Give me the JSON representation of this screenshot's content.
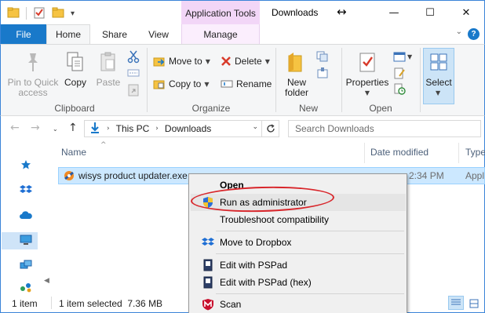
{
  "title_bar": {
    "context_tab_title": "Application Tools",
    "window_title": "Downloads",
    "move_cursor_glyph": "↔",
    "minimize_glyph": "—",
    "maximize_glyph": "☐",
    "close_glyph": "✕"
  },
  "tabs": {
    "file": "File",
    "home": "Home",
    "share": "Share",
    "view": "View",
    "manage": "Manage",
    "help": "?"
  },
  "ribbon": {
    "clipboard": {
      "pin": "Pin to Quick access",
      "copy": "Copy",
      "paste": "Paste",
      "label": "Clipboard"
    },
    "organize": {
      "move_to": "Move to",
      "copy_to": "Copy to",
      "delete": "Delete",
      "rename": "Rename",
      "label": "Organize"
    },
    "new": {
      "new_folder": "New folder",
      "label": "New"
    },
    "open": {
      "properties": "Properties",
      "label": "Open"
    },
    "select": {
      "select": "Select"
    }
  },
  "address": {
    "path": [
      "This PC",
      "Downloads"
    ],
    "search_placeholder": "Search Downloads"
  },
  "columns": {
    "name": "Name",
    "date_modified": "Date modified",
    "type": "Type"
  },
  "files": [
    {
      "name": "wisys product updater.exe",
      "date_partial": "2:34 PM",
      "type_partial": "Appl"
    }
  ],
  "status": {
    "item_count": "1 item",
    "selection": "1 item selected  7.36 MB"
  },
  "context_menu": {
    "items": [
      {
        "label": "Open",
        "bold": true
      },
      {
        "label": "Run as administrator",
        "icon": "shield-icon"
      },
      {
        "label": "Troubleshoot compatibility"
      },
      {
        "label": "Move to Dropbox",
        "icon": "dropbox-icon"
      },
      {
        "label": "Edit with PSPad",
        "icon": "pspad-icon"
      },
      {
        "label": "Edit with PSPad (hex)",
        "icon": "pspad-icon"
      },
      {
        "label": "Scan",
        "icon": "mcafee-icon"
      }
    ]
  },
  "colors": {
    "accent": "#1979ca",
    "context_tab": "#f2d6f7",
    "selection": "#cce8ff",
    "annotation": "#d8262b"
  }
}
